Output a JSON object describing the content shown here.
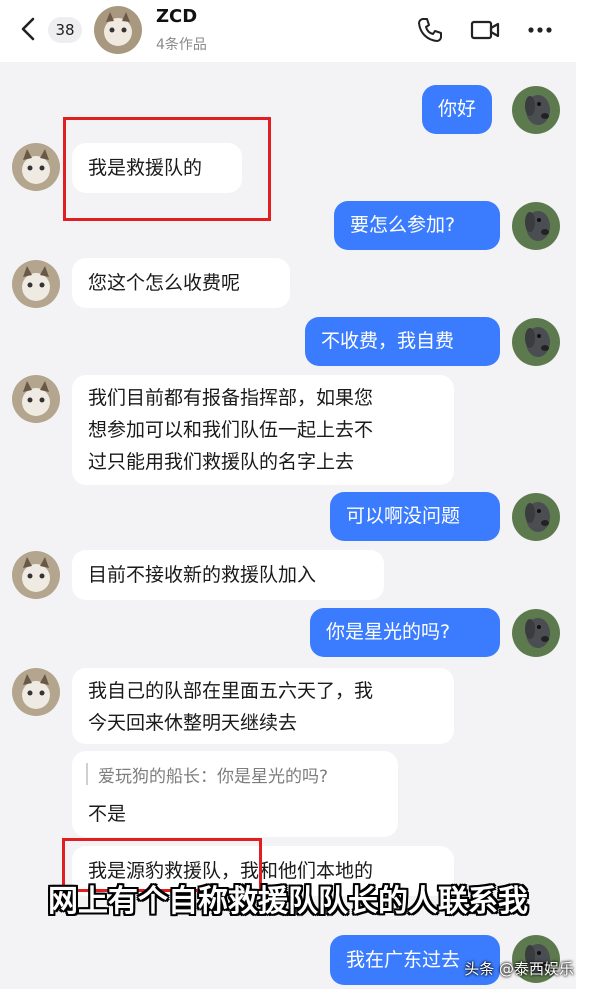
{
  "header": {
    "unread_count": "38",
    "contact_name": "ZCD",
    "contact_sub": "4条作品"
  },
  "messages": [
    {
      "side": "out",
      "text": "你好"
    },
    {
      "side": "in",
      "text": "我是救援队的"
    },
    {
      "side": "out",
      "text": "要怎么参加?"
    },
    {
      "side": "in",
      "text": "您这个怎么收费呢"
    },
    {
      "side": "out",
      "text": "不收费，我自费"
    },
    {
      "side": "in",
      "lines": [
        "我们目前都有报备指挥部，如果您",
        "想参加可以和我们队伍一起上去不",
        "过只能用我们救援队的名字上去"
      ]
    },
    {
      "side": "out",
      "text": "可以啊没问题"
    },
    {
      "side": "in",
      "text": "目前不接收新的救援队加入"
    },
    {
      "side": "out",
      "text": "你是星光的吗?"
    },
    {
      "side": "in",
      "lines": [
        "我自己的队部在里面五六天了，我",
        "今天回来休整明天继续去"
      ]
    },
    {
      "side": "in",
      "quote": "爱玩狗的船长：你是星光的吗?",
      "text": "不是"
    },
    {
      "side": "in",
      "text": "我是源豹救援队，我和他们本地的"
    },
    {
      "side": "out",
      "text": "我在广东过去"
    }
  ],
  "caption": "网上有个自称救援队队长的人联系我",
  "watermark": "头条 @泰西娱乐",
  "colors": {
    "outgoing": "#3b7cff",
    "incoming": "#ffffff",
    "highlight": "#e02020",
    "background": "#f3f3f5"
  }
}
